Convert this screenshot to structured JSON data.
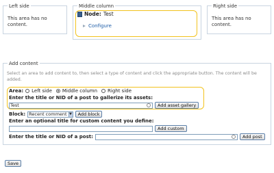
{
  "columns": {
    "left": {
      "title": "Left side",
      "empty_text": "This area has no content."
    },
    "middle": {
      "title": "Middle column",
      "node_label": "Node:",
      "node_value": "Test",
      "configure_link": "Configure"
    },
    "right": {
      "title": "Right side",
      "empty_text": "This area has no content."
    }
  },
  "add_content": {
    "title": "Add content",
    "description": "Select an area to add content to, then select a type of content and click the appropriate button. The content will be added.",
    "area_label": "Area:",
    "area_options": [
      "Left side",
      "Middle column",
      "Right side"
    ],
    "area_selected": "Middle column",
    "gallery_label": "Enter the title or NID of a post to gallerize its assets:",
    "gallery_value": "Test",
    "gallery_button": "Add asset gallery",
    "block_label": "Block:",
    "block_selected": "Recent comment",
    "block_button": "Add block",
    "custom_label": "Enter an optional title for custom content you define:",
    "custom_value": "",
    "custom_button": "Add custom",
    "post_label": "Enter the title or NID of a post:",
    "post_value": "",
    "post_button": "Add post"
  },
  "save_button": "Save"
}
